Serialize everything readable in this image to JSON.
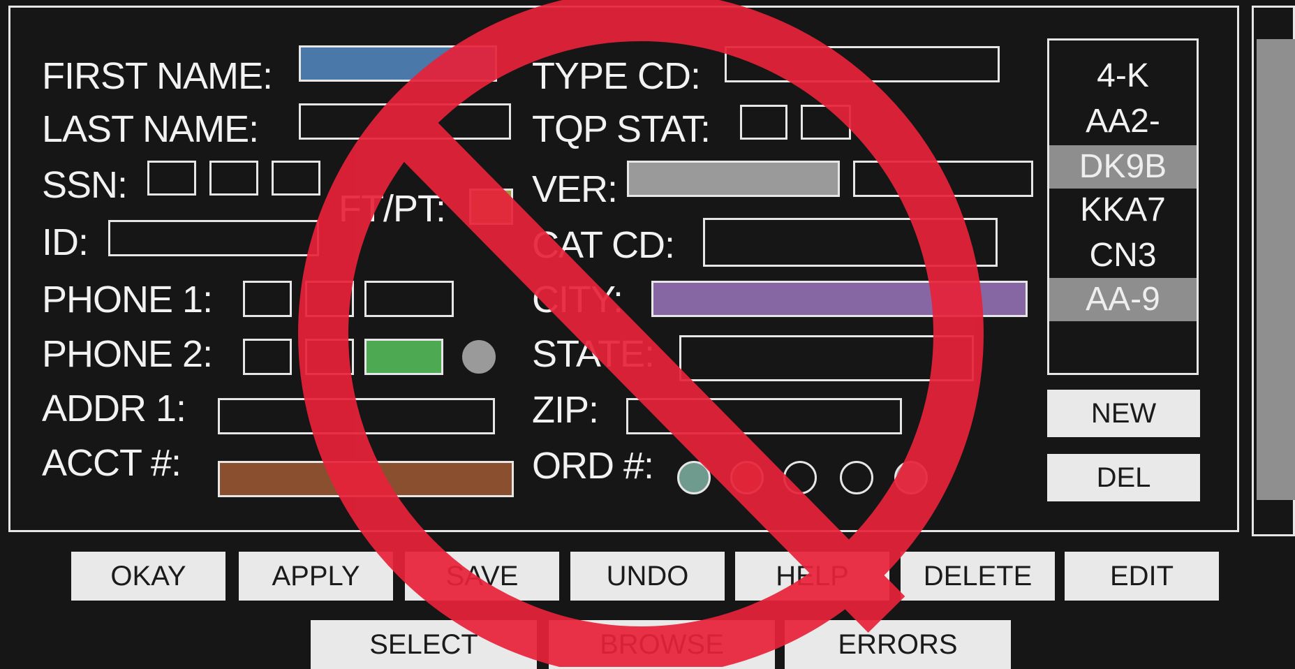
{
  "colors": {
    "first_name_fill": "#4a78a8",
    "ftpt_fill": "#a09a3e",
    "ver_fill": "#9a9a9a",
    "city_fill": "#8666a3",
    "phone2_fill": "#4daa52",
    "acct_fill": "#8a4f2f",
    "prohibit_red": "#e8223a"
  },
  "form": {
    "first_name_label": "FIRST NAME:",
    "last_name_label": "LAST NAME:",
    "ssn_label": "SSN:",
    "ftpt_label": "FT/PT:",
    "id_label": "ID:",
    "phone1_label": "PHONE 1:",
    "phone2_label": "PHONE 2:",
    "addr1_label": "ADDR 1:",
    "acct_label": "ACCT #:",
    "type_cd_label": "TYPE CD:",
    "tqp_stat_label": "TQP STAT:",
    "ver_label": "VER:",
    "cat_cd_label": "CAT CD:",
    "city_label": "CITY:",
    "state_label": "STATE:",
    "zip_label": "ZIP:",
    "ord_label": "ORD #:"
  },
  "list": {
    "items": [
      {
        "label": "4-K",
        "selected": false
      },
      {
        "label": "AA2-",
        "selected": false
      },
      {
        "label": "DK9B",
        "selected": true
      },
      {
        "label": "KKA7",
        "selected": false
      },
      {
        "label": "CN3",
        "selected": false
      },
      {
        "label": "AA-9",
        "selected": true
      }
    ],
    "new_label": "NEW",
    "del_label": "DEL"
  },
  "buttons": {
    "row1": [
      "OKAY",
      "APPLY",
      "SAVE",
      "UNDO",
      "HELP",
      "DELETE",
      "EDIT"
    ],
    "row2": [
      "SELECT",
      "BROWSE",
      "ERRORS"
    ]
  },
  "overlay": {
    "icon": "prohibition-icon"
  }
}
